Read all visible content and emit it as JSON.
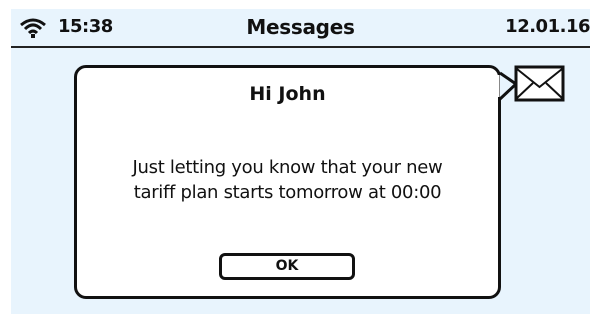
{
  "status_bar": {
    "wifi_icon": "wifi-icon",
    "time": "15:38",
    "title": "Messages",
    "date": "12.01.16"
  },
  "notification": {
    "icon": "envelope-icon"
  },
  "dialog": {
    "heading": "Hi John",
    "body_line1": "Just letting you know that your new",
    "body_line2": "tariff plan starts tomorrow at 00:00",
    "ok_label": "OK"
  },
  "colors": {
    "screen_background": "#e8f4fd",
    "dialog_background": "#ffffff",
    "ink": "#111111"
  }
}
